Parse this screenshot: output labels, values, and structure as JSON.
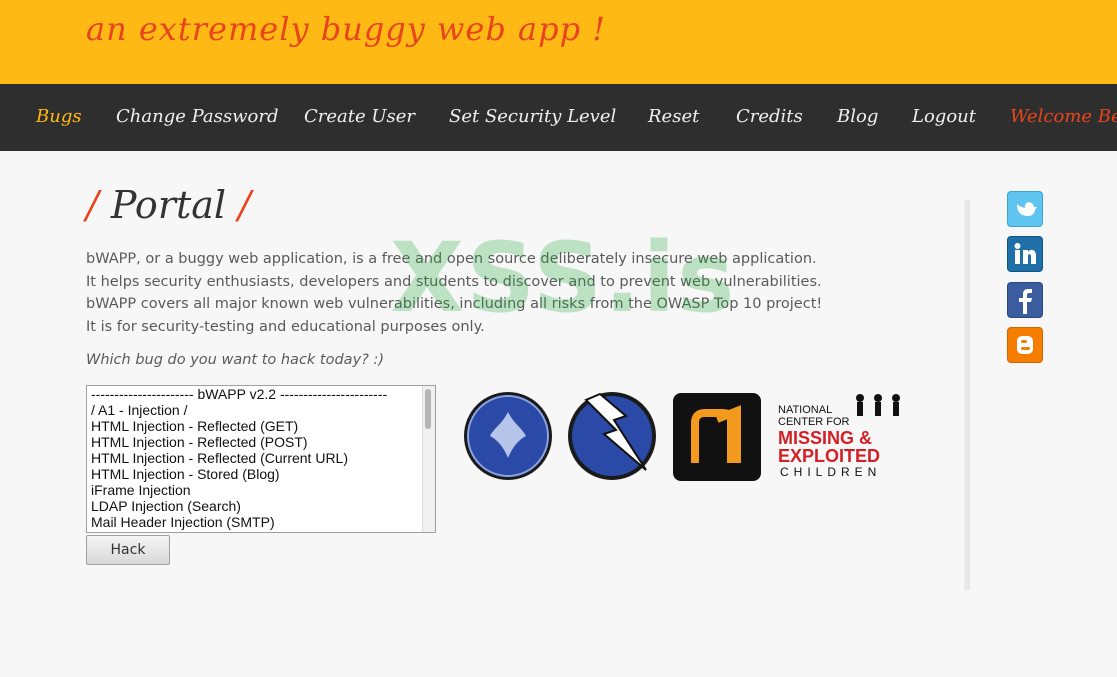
{
  "header": {
    "slogan": "an extremely buggy web app !"
  },
  "menu": {
    "items": [
      {
        "label": "Bugs"
      },
      {
        "label": "Change Password"
      },
      {
        "label": "Create User"
      },
      {
        "label": "Set Security Level"
      },
      {
        "label": "Reset"
      },
      {
        "label": "Credits"
      },
      {
        "label": "Blog"
      },
      {
        "label": "Logout"
      },
      {
        "label": "Welcome Be"
      }
    ]
  },
  "page": {
    "title": "Portal",
    "title_slash": "/",
    "paragraphs": [
      "bWAPP, or a buggy web application, is a free and open source deliberately insecure web application.",
      "It helps security enthusiasts, developers and students to discover and to prevent web vulnerabilities.",
      "bWAPP covers all major known web vulnerabilities, including all risks from the OWASP Top 10 project!",
      "It is for security-testing and educational purposes only."
    ],
    "question": "Which bug do you want to hack today? :)",
    "watermark": "XSS.is"
  },
  "bug_list": {
    "options": [
      "---------------------- bWAPP v2.2 -----------------------",
      "/ A1 - Injection /",
      "HTML Injection - Reflected (GET)",
      "HTML Injection - Reflected (POST)",
      "HTML Injection - Reflected (Current URL)",
      "HTML Injection - Stored (Blog)",
      "iFrame Injection",
      "LDAP Injection (Search)",
      "Mail Header Injection (SMTP)"
    ]
  },
  "hack_button": {
    "label": "Hack"
  },
  "logos": {
    "nmcec_line1": "NATIONAL",
    "nmcec_line2": "CENTER FOR",
    "nmcec_line3": "MISSING &",
    "nmcec_line4": "EXPLOITED",
    "nmcec_line5": "CHILDREN"
  },
  "social": [
    "twitter-icon",
    "linkedin-icon",
    "facebook-icon",
    "blogger-icon"
  ],
  "colors": {
    "header": "#ffb914",
    "accent": "#e8451e",
    "menu_bg": "#2e2e2e"
  }
}
